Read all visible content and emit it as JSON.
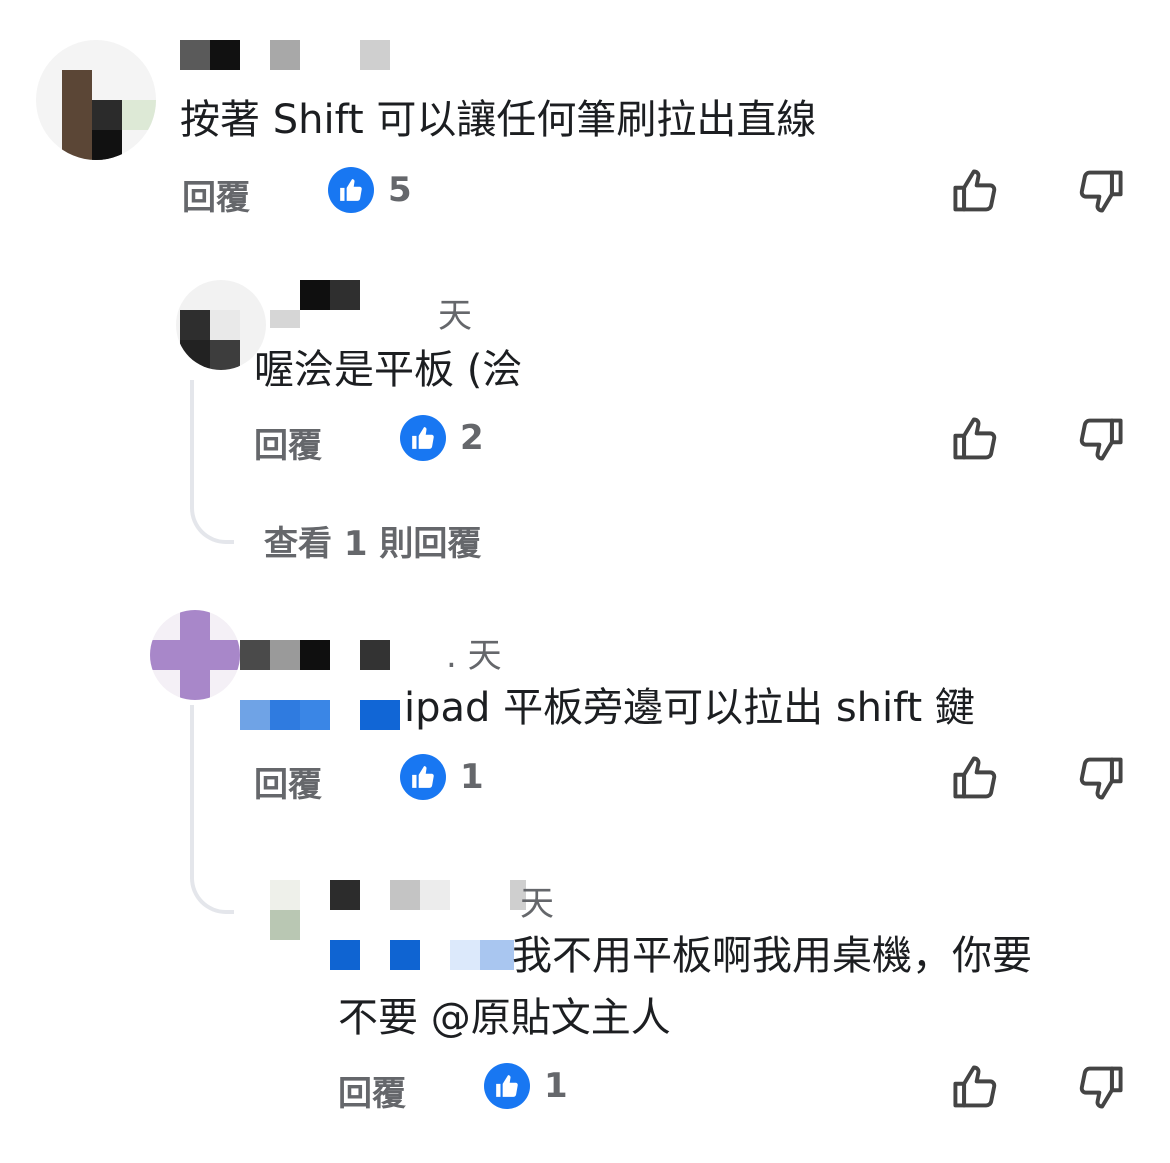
{
  "comments": [
    {
      "time": "",
      "text": "按著 Shift 可以讓任何筆刷拉出直線",
      "reply_label": "回覆",
      "like_count": "5"
    },
    {
      "time": "天",
      "text": "喔浍是平板 (浍",
      "reply_label": "回覆",
      "like_count": "2",
      "view_replies": "查看 1 則回覆"
    },
    {
      "time": ". 天",
      "text": "ipad 平板旁邊可以拉出 shift 鍵",
      "reply_label": "回覆",
      "like_count": "1"
    },
    {
      "time": "天",
      "text_line1": "我不用平板啊我用桌機，你要",
      "text_line2": "不要 @原貼文主人",
      "reply_label": "回覆",
      "like_count": "1"
    }
  ],
  "icons": {
    "like_reaction": "thumbs-up-reaction-icon",
    "upvote": "thumbs-up-outline-icon",
    "downvote": "thumbs-down-outline-icon"
  },
  "colors": {
    "like_blue": "#1877f2",
    "secondary_text": "#65676b",
    "primary_text": "#1c1e21"
  }
}
